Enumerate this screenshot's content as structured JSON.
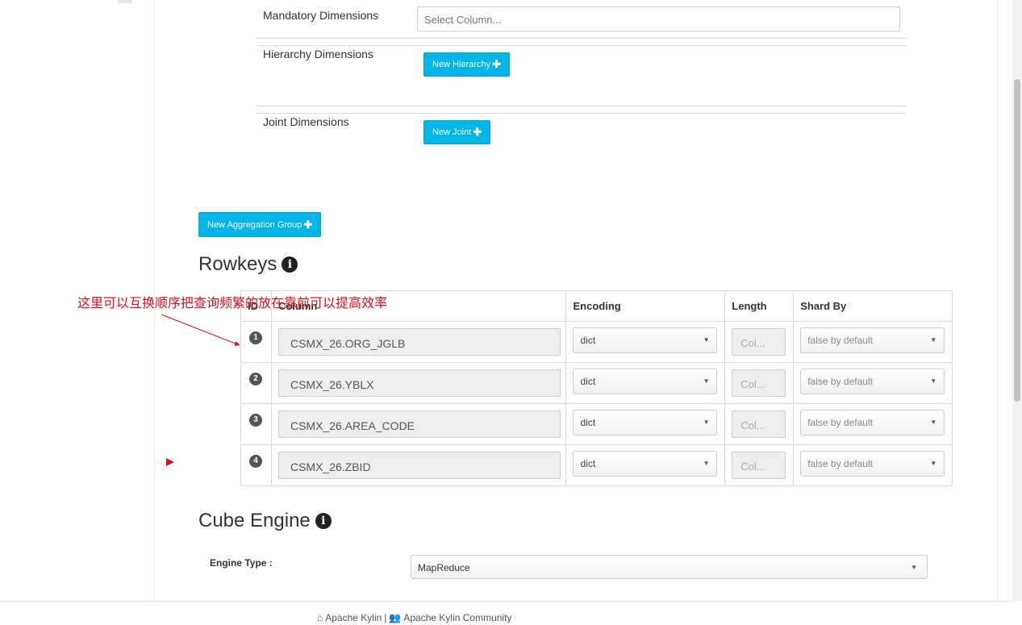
{
  "aggregation": {
    "mandatory_label": "Mandatory Dimensions",
    "mandatory_placeholder": "Select Column...",
    "hierarchy_label": "Hierarchy Dimensions",
    "new_hierarchy_label": "New Hierarchy",
    "joint_label": "Joint Dimensions",
    "new_joint_label": "New Joint",
    "new_group_label": "New Aggregation Group"
  },
  "rowkeys": {
    "title": "Rowkeys",
    "headers": {
      "id": "ID",
      "column": "Column",
      "encoding": "Encoding",
      "length": "Length",
      "shard_by": "Shard By"
    },
    "rows": [
      {
        "id": "1",
        "column": "CSMX_26.ORG_JGLB",
        "encoding": "dict",
        "length": "Col...",
        "shard_by": "false by default"
      },
      {
        "id": "2",
        "column": "CSMX_26.YBLX",
        "encoding": "dict",
        "length": "Col...",
        "shard_by": "false by default"
      },
      {
        "id": "3",
        "column": "CSMX_26.AREA_CODE",
        "encoding": "dict",
        "length": "Col...",
        "shard_by": "false by default"
      },
      {
        "id": "4",
        "column": "CSMX_26.ZBID",
        "encoding": "dict",
        "length": "Col...",
        "shard_by": "false by default"
      }
    ]
  },
  "annotation": {
    "text": "这里可以互换顺序把查询频繁的放在靠前可以提高效率",
    "color": "#e0101a"
  },
  "cube_engine": {
    "title": "Cube Engine",
    "engine_type_label": "Engine Type :",
    "engine_type_value": "MapReduce"
  },
  "footer": {
    "home_link": "Apache Kylin",
    "separator": "|",
    "community_link": "Apache Kylin Community",
    "home_icon": "home-icon",
    "community_icon": "users-icon"
  },
  "colors": {
    "button": "#00b6e9",
    "annotation": "#e0101a"
  }
}
